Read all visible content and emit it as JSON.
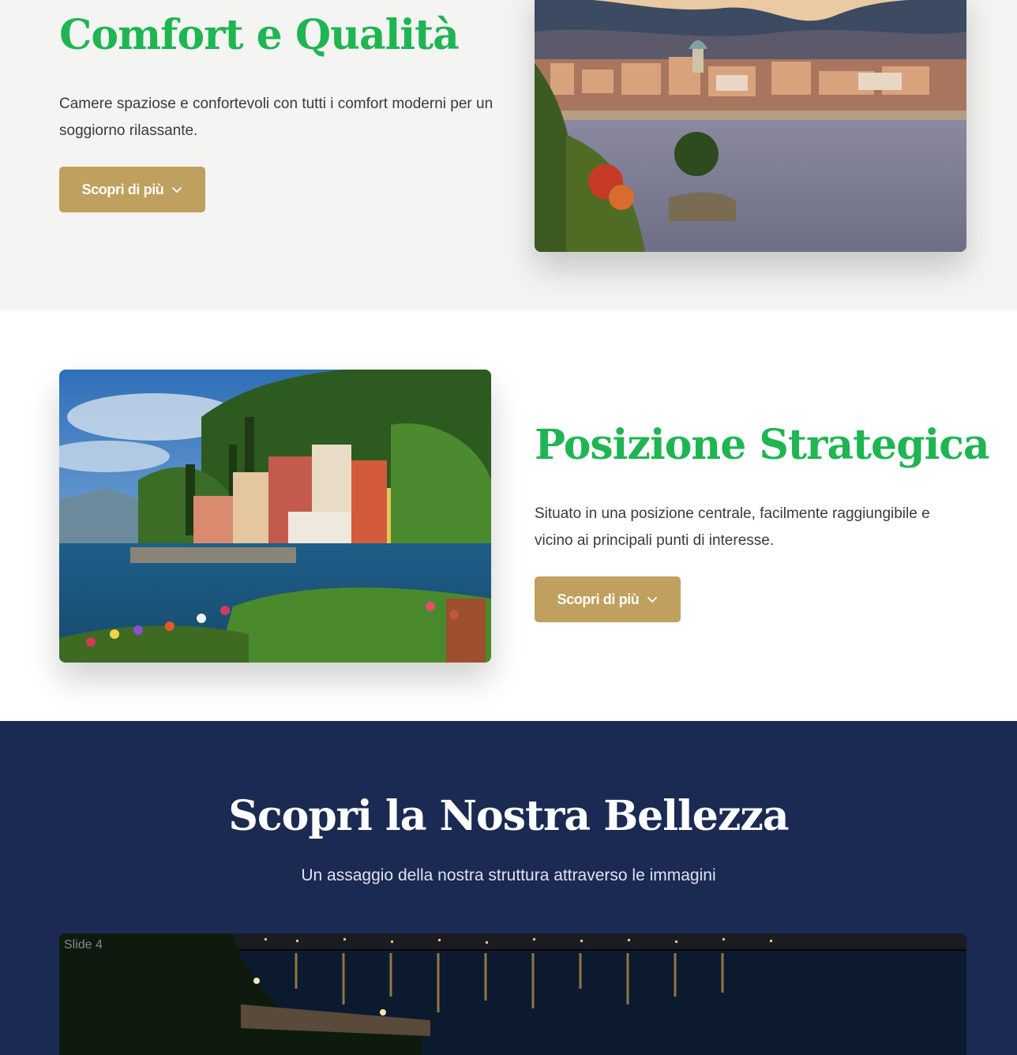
{
  "sections": {
    "comfort": {
      "title": "Comfort e Qualità",
      "text": "Camere spaziose e confortevoli con tutti i comfort moderni per un soggiorno rilassante.",
      "button_label": "Scopri di più",
      "image_icon": "lake-city-photo"
    },
    "position": {
      "title": "Posizione Strategica",
      "text": "Situato in una posizione centrale, facilmente raggiungibile e vicino ai principali punti di interesse.",
      "button_label": "Scopri di più",
      "image_icon": "lakeside-village-photo"
    },
    "gallery": {
      "title": "Scopri la Nostra Bellezza",
      "subtitle": "Un assaggio della nostra struttura attraverso le immagini",
      "slide_alt": "Slide 4"
    }
  },
  "colors": {
    "accent_green": "#1fb552",
    "button_gold": "#bfa05f",
    "navy": "#1b2a52",
    "light_bg": "#f4f4f2"
  }
}
